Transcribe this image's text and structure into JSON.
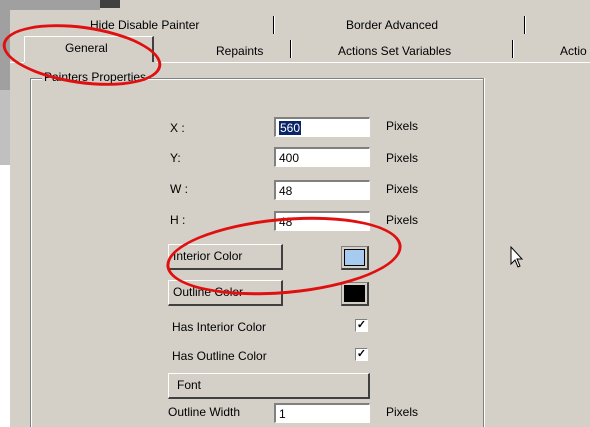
{
  "tabs_row_back": [
    {
      "label": "Hide Disable Painter"
    },
    {
      "label": "Border Advanced"
    }
  ],
  "tabs_row_front": [
    {
      "label": "General"
    },
    {
      "label": "Repaints"
    },
    {
      "label": "Actions Set Variables"
    },
    {
      "label": "Actio"
    }
  ],
  "group": {
    "title": "Painters Properties"
  },
  "fields": {
    "x": {
      "label": "X :",
      "value": "560",
      "unit": "Pixels"
    },
    "y": {
      "label": "Y:",
      "value": "400",
      "unit": "Pixels"
    },
    "w": {
      "label": "W :",
      "value": "48",
      "unit": "Pixels"
    },
    "h": {
      "label": "H :",
      "value": "48",
      "unit": "Pixels"
    }
  },
  "buttons": {
    "interior_color": "Interior Color",
    "outline_color": "Outline Color",
    "font": "Font"
  },
  "swatches": {
    "interior_color": "#a6caf0",
    "outline_color": "#000000"
  },
  "checkboxes": {
    "has_interior_color": {
      "label": "Has Interior Color",
      "checked": true,
      "mark": "✓"
    },
    "has_outline_color": {
      "label": "Has Outline Color",
      "checked": true,
      "mark": "✓"
    }
  },
  "outline_width": {
    "label": "Outline Width",
    "value": "1",
    "unit": "Pixels"
  },
  "annotation_color": "#e01010"
}
